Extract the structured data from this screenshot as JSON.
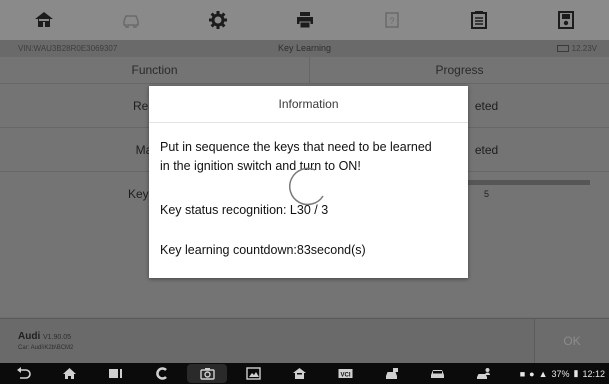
{
  "toolbar": {
    "buttons": [
      {
        "icon": "home-icon",
        "active": true
      },
      {
        "icon": "car-icon",
        "active": false
      },
      {
        "icon": "gear-icon",
        "active": true
      },
      {
        "icon": "printer-icon",
        "active": true
      },
      {
        "icon": "help-icon",
        "active": false
      },
      {
        "icon": "report-icon",
        "active": true
      },
      {
        "icon": "save-icon",
        "active": true
      }
    ]
  },
  "infostrip": {
    "vin": "VIN:WAU3B28R0E3069307",
    "title": "Key Learning",
    "battery": "12.23V"
  },
  "table": {
    "headers": {
      "function": "Function",
      "progress": "Progress"
    },
    "rows": [
      {
        "function": "Read IN",
        "progress": "eted"
      },
      {
        "function": "Make c",
        "progress": "eted"
      },
      {
        "function": "Key adapt",
        "progress": "5"
      }
    ]
  },
  "bottombar": {
    "car_make": "Audi",
    "version": "V1.90.05",
    "car_path": "Car: Audi\\K2b\\BCM2",
    "ok_label": "OK"
  },
  "navbar": {
    "icons": [
      "back-icon",
      "home-icon",
      "recent-apps-icon",
      "browser-icon",
      "camera-icon",
      "screenshot-icon",
      "maxisys-home-icon",
      "vci-icon",
      "car-shop-icon",
      "car-icon",
      "car-person-icon"
    ],
    "status": {
      "battery_percent": "37%",
      "time": "12:12"
    }
  },
  "dialog": {
    "title": "Information",
    "instruction": "Put in sequence the keys that need to be learned in the ignition switch and turn to ON!",
    "instruction_line1": "Put in sequence the keys that need to be learned",
    "instruction_line2": "in the ignition switch and turn to ON!",
    "status_text": "Key status recognition: L30 / 3",
    "countdown_text": "Key learning countdown:83second(s)"
  }
}
